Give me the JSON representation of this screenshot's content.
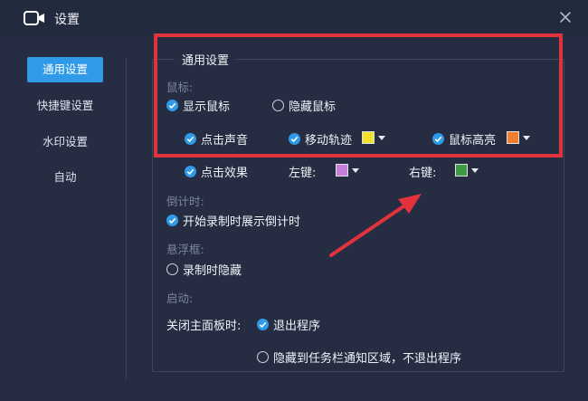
{
  "window": {
    "title": "设置",
    "close_icon": "close-icon",
    "app_icon": "video-camera-icon"
  },
  "sidebar": {
    "items": [
      {
        "label": "通用设置",
        "active": true
      },
      {
        "label": "快捷键设置",
        "active": false
      },
      {
        "label": "水印设置",
        "active": false
      },
      {
        "label": "自动",
        "active": false
      }
    ]
  },
  "general": {
    "group_title": "通用设置",
    "mouse": {
      "label": "鼠标:",
      "show_cursor": "显示鼠标",
      "hide_cursor": "隐藏鼠标",
      "click_sound": "点击声音",
      "move_trail": "移动轨迹",
      "move_trail_color": "#f3e22c",
      "cursor_highlight": "鼠标高亮",
      "cursor_highlight_color": "#ee7d2f",
      "click_effect": "点击效果",
      "left_key": "左键:",
      "left_key_color": "#c57fd8",
      "right_key": "右键:",
      "right_key_color": "#3f9a44"
    },
    "countdown": {
      "label": "倒计时:",
      "show_countdown": "开始录制时展示倒计时"
    },
    "floating": {
      "label": "悬浮框:",
      "hide_while_recording": "录制时隐藏"
    },
    "startup": {
      "label": "启动:"
    },
    "close_panel": {
      "label": "关闭主面板时:",
      "exit_program": "退出程序",
      "hide_to_tray": "隐藏到任务栏通知区域，不退出程序"
    }
  }
}
